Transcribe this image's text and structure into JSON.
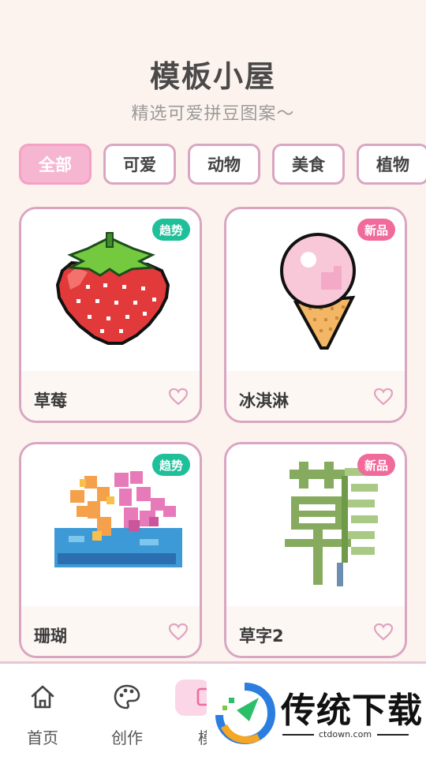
{
  "header": {
    "title": "模板小屋",
    "subtitle": "精选可爱拼豆图案～"
  },
  "tabs": [
    {
      "label": "全部",
      "active": true
    },
    {
      "label": "可爱",
      "active": false
    },
    {
      "label": "动物",
      "active": false
    },
    {
      "label": "美食",
      "active": false
    },
    {
      "label": "植物",
      "active": false
    }
  ],
  "cards": [
    {
      "name": "草莓",
      "badge": "趋势",
      "badge_type": "trend"
    },
    {
      "name": "冰淇淋",
      "badge": "新品",
      "badge_type": "new"
    },
    {
      "name": "珊瑚",
      "badge": "趋势",
      "badge_type": "trend"
    },
    {
      "name": "草字2",
      "badge": "新品",
      "badge_type": "new"
    }
  ],
  "nav": [
    {
      "label": "首页",
      "icon": "home-icon"
    },
    {
      "label": "创作",
      "icon": "palette-icon"
    },
    {
      "label": "模",
      "icon": "template-icon",
      "active": true
    }
  ],
  "watermark": {
    "text": "传统下载",
    "url": "ctdown.com"
  },
  "colors": {
    "accent_pink": "#f6b6d2",
    "border_pink": "#d9a6c2",
    "trend_badge": "#1fbf9a",
    "new_badge": "#f06b9b",
    "background": "#fdf3ee"
  }
}
